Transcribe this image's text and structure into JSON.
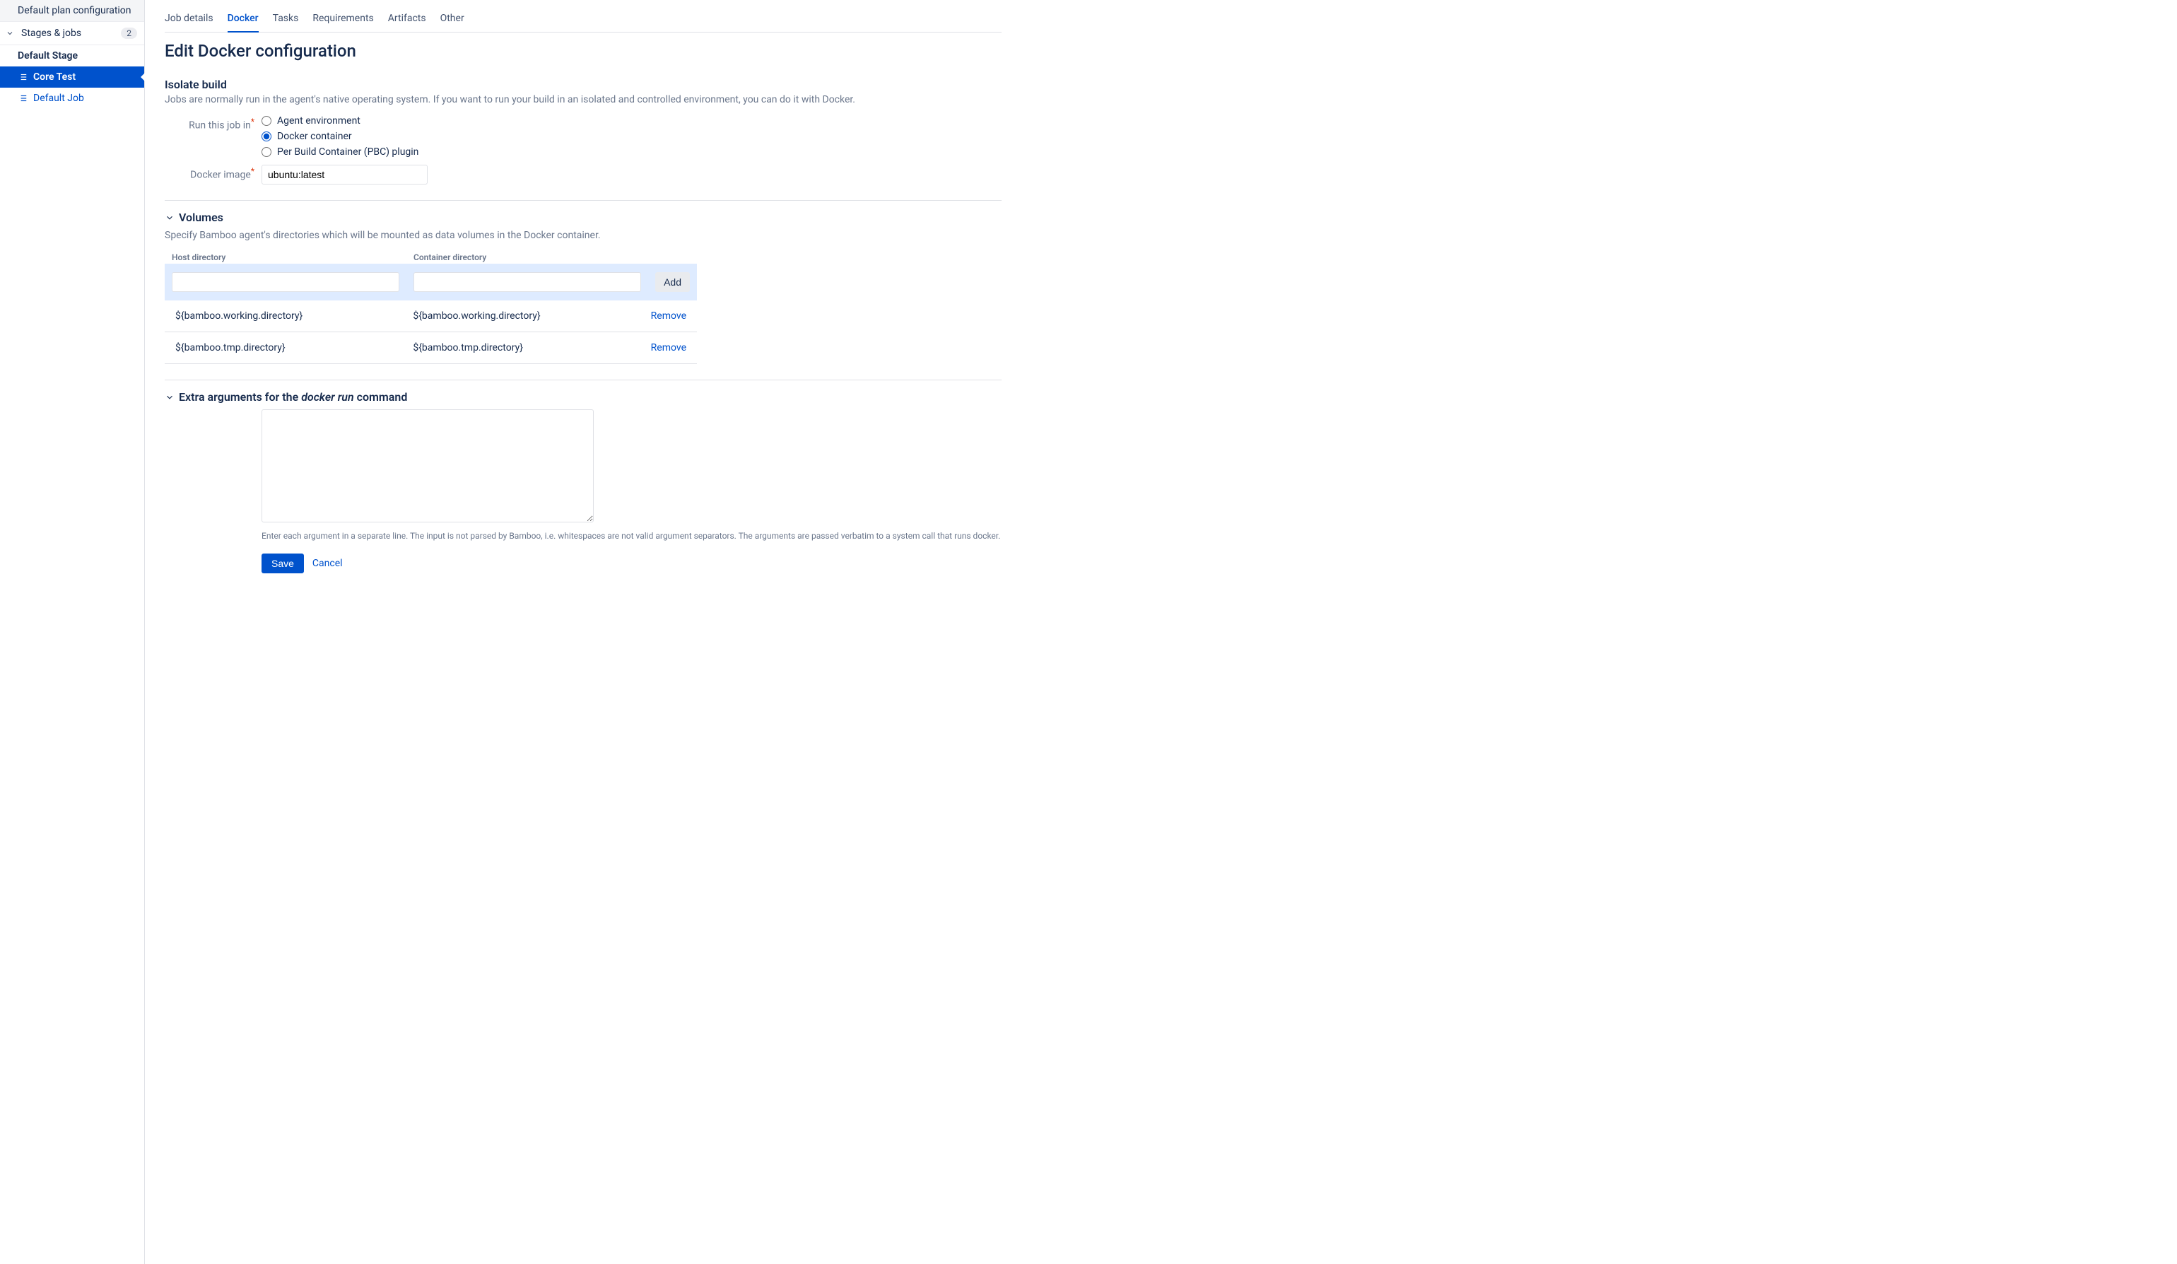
{
  "sidebar": {
    "default_plan": "Default plan configuration",
    "stages_jobs": "Stages & jobs",
    "stages_count": "2",
    "stage_name": "Default Stage",
    "jobs": [
      {
        "label": "Core Test",
        "active": true
      },
      {
        "label": "Default Job",
        "active": false
      }
    ]
  },
  "tabs": [
    {
      "label": "Job details",
      "active": false
    },
    {
      "label": "Docker",
      "active": true
    },
    {
      "label": "Tasks",
      "active": false
    },
    {
      "label": "Requirements",
      "active": false
    },
    {
      "label": "Artifacts",
      "active": false
    },
    {
      "label": "Other",
      "active": false
    }
  ],
  "page_title": "Edit Docker configuration",
  "isolate": {
    "heading": "Isolate build",
    "desc": "Jobs are normally run in the agent's native operating system. If you want to run your build in an isolated and controlled environment, you can do it with Docker.",
    "run_label": "Run this job in",
    "options": {
      "agent": "Agent environment",
      "docker": "Docker container",
      "pbc": "Per Build Container (PBC) plugin"
    },
    "image_label": "Docker image",
    "image_value": "ubuntu:latest"
  },
  "volumes": {
    "heading": "Volumes",
    "desc": "Specify Bamboo agent's directories which will be mounted as data volumes in the Docker container.",
    "col_host": "Host directory",
    "col_container": "Container directory",
    "add_label": "Add",
    "remove_label": "Remove",
    "rows": [
      {
        "host": "${bamboo.working.directory}",
        "container": "${bamboo.working.directory}"
      },
      {
        "host": "${bamboo.tmp.directory}",
        "container": "${bamboo.tmp.directory}"
      }
    ]
  },
  "extra": {
    "heading_pre": "Extra arguments for the ",
    "heading_em": "docker run",
    "heading_post": " command",
    "value": "",
    "hint": "Enter each argument in a separate line. The input is not parsed by Bamboo, i.e. whitespaces are not valid argument separators. The arguments are passed verbatim to a system call that runs docker."
  },
  "actions": {
    "save": "Save",
    "cancel": "Cancel"
  }
}
